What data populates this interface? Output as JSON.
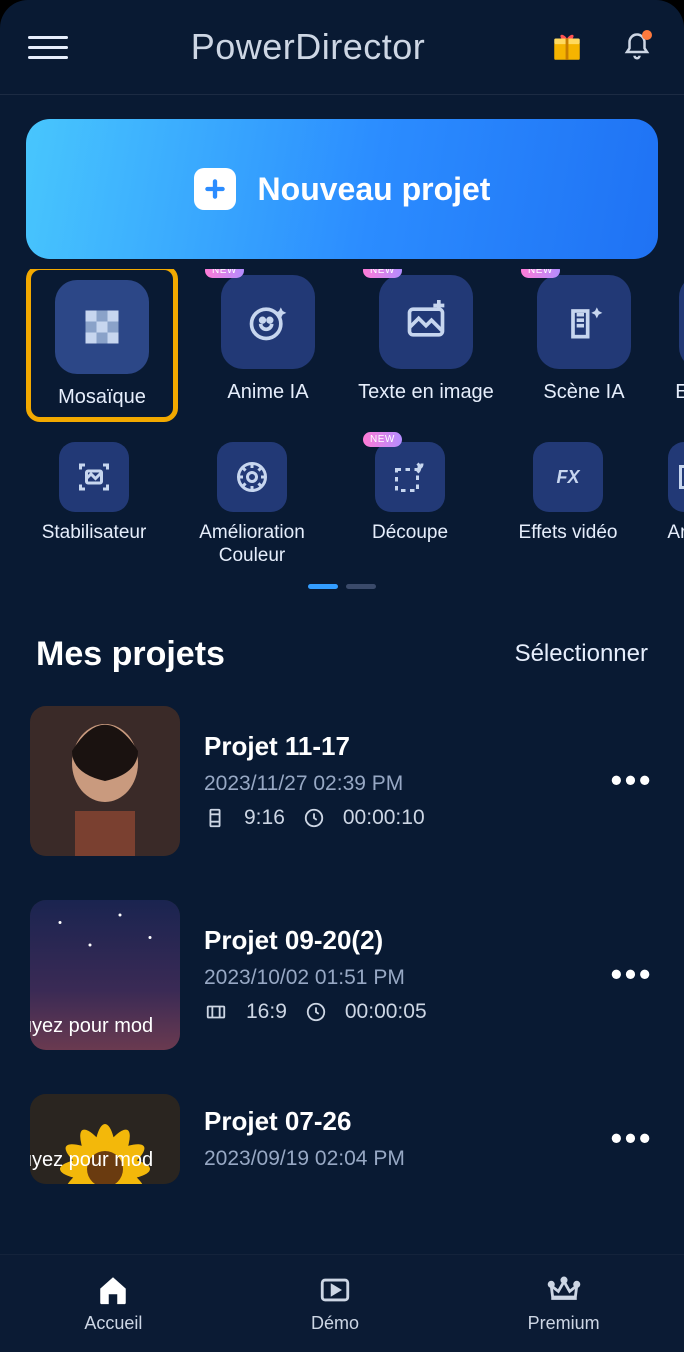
{
  "header": {
    "title": "PowerDirector"
  },
  "hero": {
    "label": "Nouveau projet"
  },
  "tools_row1": [
    {
      "label": "Mosaïque",
      "highlight": true,
      "new": false,
      "icon": "mosaic-icon"
    },
    {
      "label": "Anime IA",
      "new": true,
      "icon": "smiley-sparkle-icon"
    },
    {
      "label": "Texte en image",
      "new": true,
      "icon": "image-text-icon"
    },
    {
      "label": "Scène IA",
      "new": true,
      "icon": "scene-sparkle-icon"
    },
    {
      "label": "Effet d",
      "new": false,
      "icon": "effect-icon",
      "partial": true
    }
  ],
  "tools_row2": [
    {
      "label": "Stabilisateur",
      "icon": "stabilizer-icon",
      "new": false
    },
    {
      "label": "Amélioration\nCouleur",
      "icon": "color-wheel-icon",
      "new": false
    },
    {
      "label": "Découpe",
      "icon": "crop-scissors-icon",
      "new": true
    },
    {
      "label": "Effets vidéo",
      "icon": "fx-icon",
      "new": false
    },
    {
      "label": "Art A",
      "icon": "art-icon",
      "partial": true,
      "new": false
    }
  ],
  "new_badge_text": "NEW",
  "projects": {
    "title": "Mes projets",
    "select_label": "Sélectionner",
    "items": [
      {
        "name": "Projet 11-17",
        "date": "2023/11/27  02:39 PM",
        "ratio": "9:16",
        "duration": "00:00:10",
        "thumb": "woman"
      },
      {
        "name": "Projet 09-20(2)",
        "date": "2023/10/02  01:51 PM",
        "ratio": "16:9",
        "duration": "00:00:05",
        "overlay": "uyez pour mod",
        "thumb": "night"
      },
      {
        "name": "Projet 07-26",
        "date": "2023/09/19  02:04 PM",
        "overlay": "uyez pour mod",
        "thumb": "flower",
        "partial": true
      }
    ]
  },
  "tabs": [
    {
      "label": "Accueil",
      "icon": "home-icon",
      "active": true
    },
    {
      "label": "Démo",
      "icon": "play-frame-icon"
    },
    {
      "label": "Premium",
      "icon": "crown-icon"
    }
  ]
}
